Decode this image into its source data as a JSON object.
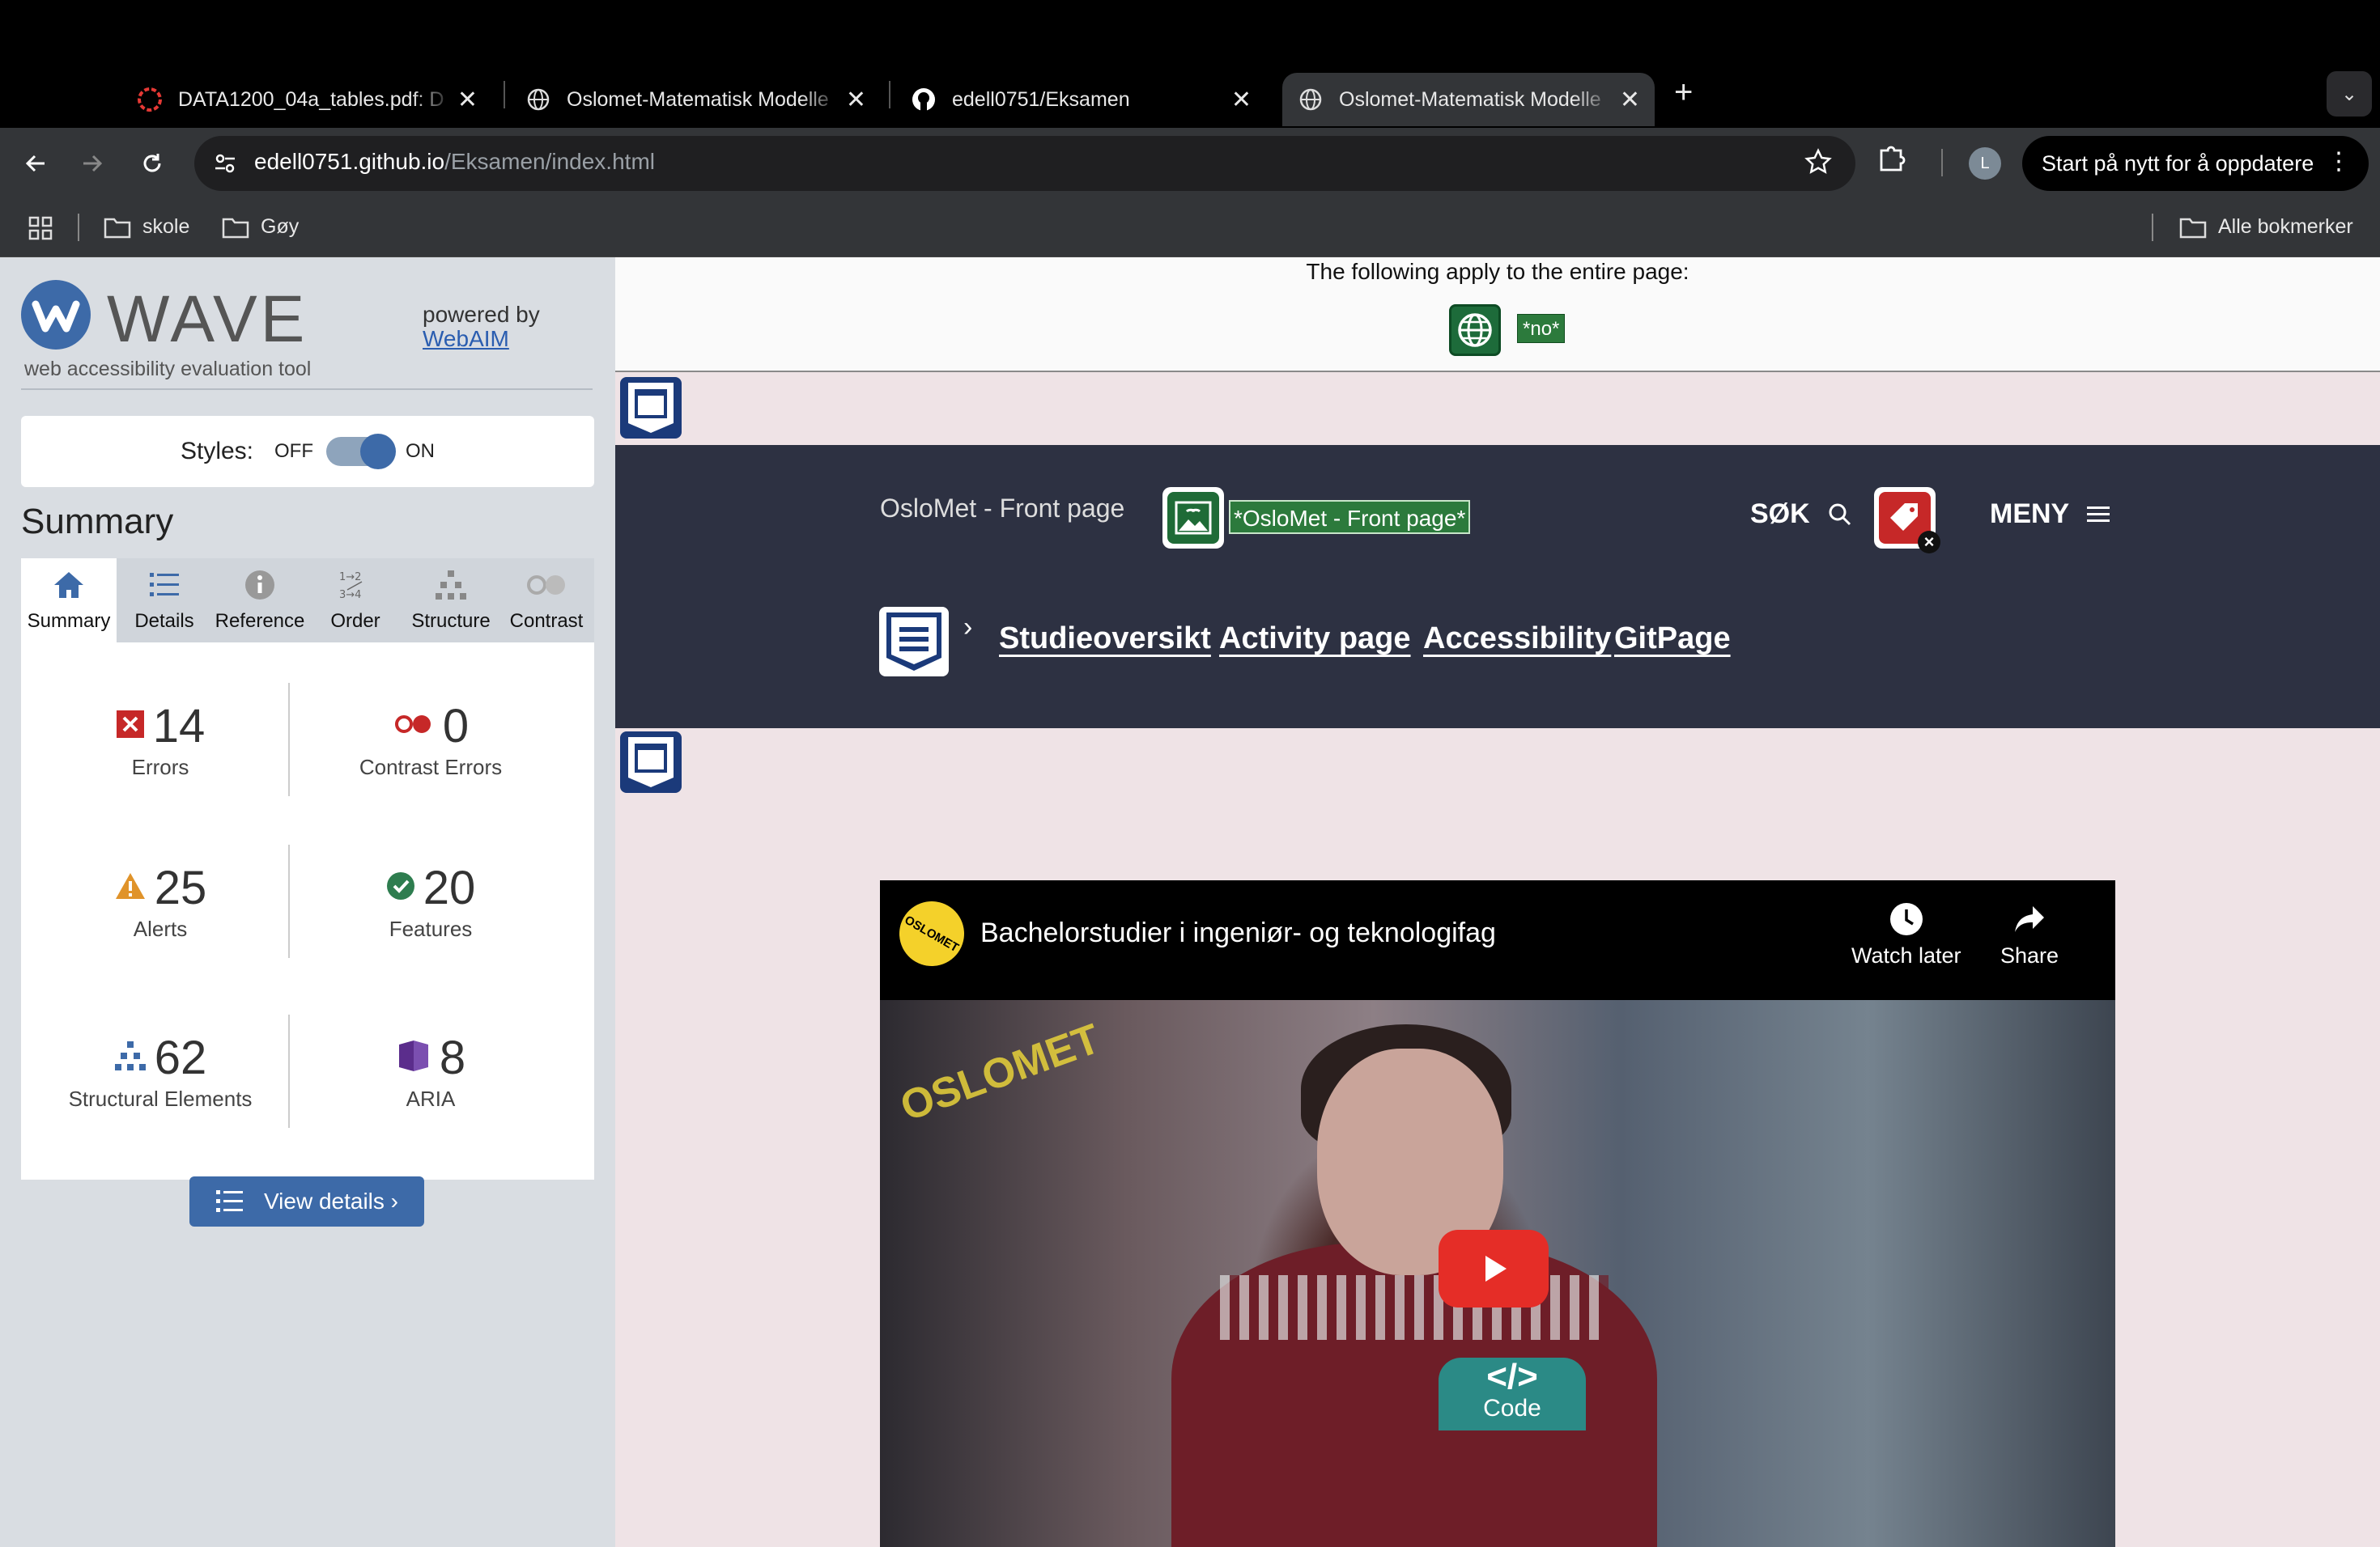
{
  "tabs": [
    {
      "title": "DATA1200_04a_tables.pdf: D",
      "icon": "pdf-icon"
    },
    {
      "title": "Oslomet-Matematisk Modelle",
      "icon": "globe-icon"
    },
    {
      "title": "edell0751/Eksamen",
      "icon": "github-icon"
    },
    {
      "title": "Oslomet-Matematisk Modelle",
      "icon": "globe-icon"
    }
  ],
  "toolbar": {
    "url_host": "edell0751.github.io",
    "url_path": "/Eksamen/index.html",
    "profile_initial": "L",
    "restart_label": "Start på nytt for å oppdatere"
  },
  "bookmarks": {
    "folders": [
      "skole",
      "Gøy"
    ],
    "all_label": "Alle bokmerker"
  },
  "wave": {
    "title": "WAVE",
    "subtitle": "web accessibility evaluation tool",
    "powered_by": "powered by",
    "powered_link": "WebAIM",
    "styles_label": "Styles:",
    "styles_off": "OFF",
    "styles_on": "ON",
    "summary_heading": "Summary",
    "tabs": [
      "Summary",
      "Details",
      "Reference",
      "Order",
      "Structure",
      "Contrast"
    ],
    "stats": {
      "errors": {
        "value": "14",
        "label": "Errors"
      },
      "contrast": {
        "value": "0",
        "label": "Contrast Errors"
      },
      "alerts": {
        "value": "25",
        "label": "Alerts"
      },
      "features": {
        "value": "20",
        "label": "Features"
      },
      "structure": {
        "value": "62",
        "label": "Structural Elements"
      },
      "aria": {
        "value": "8",
        "label": "ARIA"
      }
    },
    "view_details": "View details ›",
    "colors": {
      "accent": "#3d6aa8",
      "error": "#c62828",
      "alert": "#e0932a",
      "feature": "#2e7d4f",
      "aria": "#5b2d8c"
    }
  },
  "page": {
    "applies_text": "The following apply to the entire page:",
    "lang_tag": "*no*",
    "logo_alt": "OsloMet - Front page",
    "alt_tag": "*OsloMet - Front page*",
    "search_label": "SØK",
    "menu_label": "MENY",
    "nav_links": [
      "Studieoversikt",
      "Activity page",
      "Accessibility",
      "GitPage"
    ],
    "header_bg": "#2d3142",
    "video": {
      "channel_badge": "OSLOMET",
      "title": "Bachelorstudier i ingeniør- og teknologifag",
      "watch_later": "Watch later",
      "share": "Share",
      "watermark": "OSLOMET"
    },
    "code_badge": {
      "symbol": "</>",
      "label": "Code"
    }
  }
}
